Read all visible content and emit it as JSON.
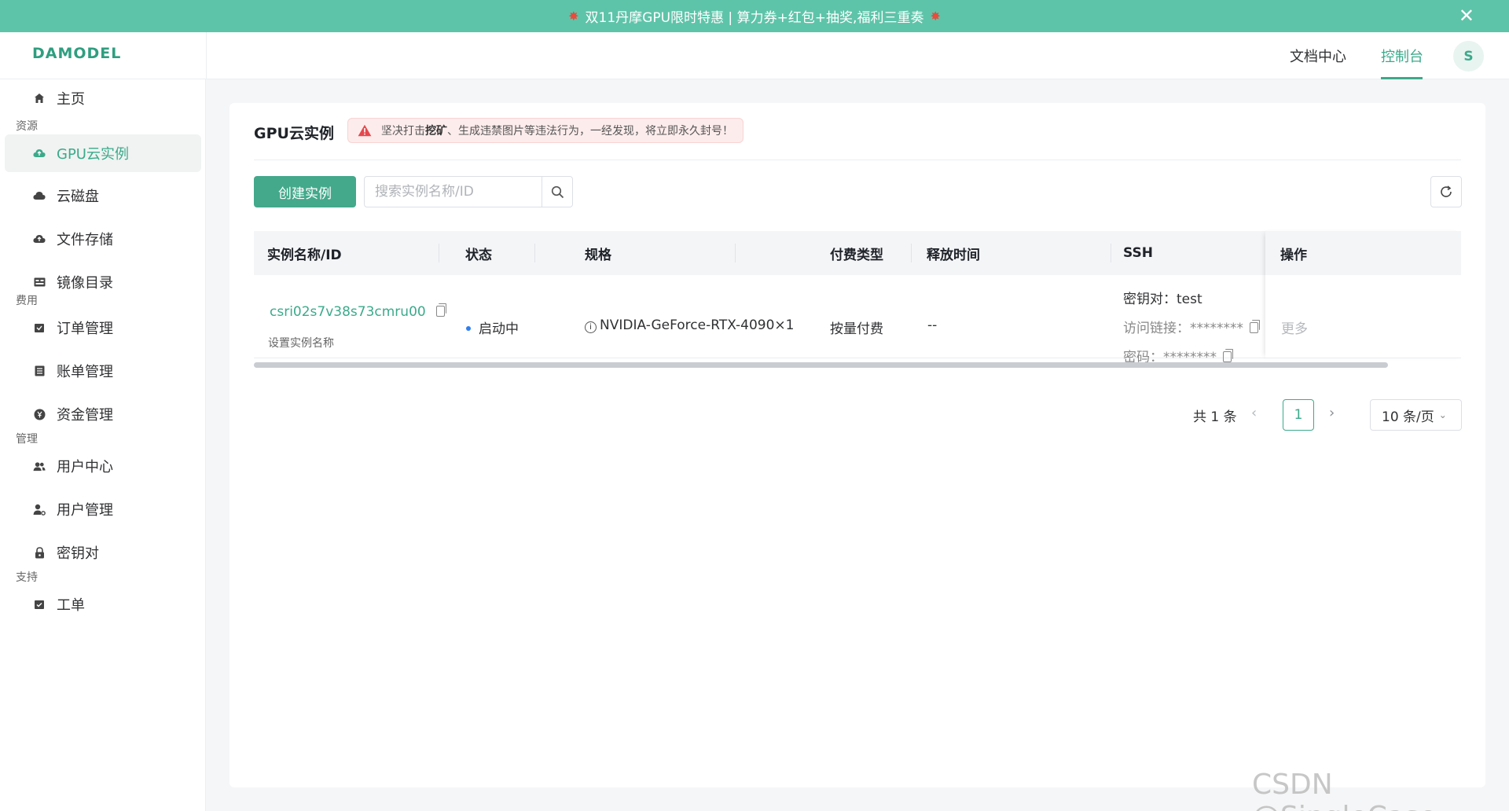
{
  "banner": {
    "text": "双11丹摩GPU限时特惠 | 算力券+红包+抽奖,福利三重奏",
    "close_icon": "close-icon"
  },
  "header": {
    "logo": "DAMODEL",
    "nav": {
      "docs": "文档中心",
      "console": "控制台"
    },
    "avatar": "S",
    "accent_color": "#3caa8a"
  },
  "sidebar": {
    "home": "主页",
    "sections": {
      "resources": "资源",
      "billing": "费用",
      "management": "管理",
      "support": "支持"
    },
    "items": {
      "gpu": "GPU云实例",
      "disk": "云磁盘",
      "storage": "文件存储",
      "images": "镜像目录",
      "orders": "订单管理",
      "bills": "账单管理",
      "funds": "资金管理",
      "user_center": "用户中心",
      "user_mgmt": "用户管理",
      "keypair": "密钥对",
      "ticket": "工单"
    }
  },
  "main": {
    "title": "GPU云实例",
    "warning": {
      "prefix": "坚决打击 ",
      "bold": "挖矿",
      "suffix": "、生成违禁图片等违法行为，一经发现，将立即永久封号！"
    },
    "create_button": "创建实例",
    "search_placeholder": "搜索实例名称/ID"
  },
  "table": {
    "headers": {
      "name": "实例名称/ID",
      "status": "状态",
      "spec": "规格",
      "billing": "付费类型",
      "release": "释放时间",
      "ssh": "SSH",
      "actions": "操作"
    },
    "row": {
      "id": "csri02s7v38s73cmru00",
      "set_name": "设置实例名称",
      "status": "启动中",
      "status_color": "#2f7ff0",
      "spec": "NVIDIA-GeForce-RTX-4090×1",
      "billing": "按量付费",
      "release": "--",
      "ssh_keypair": "密钥对：test",
      "ssh_link_label": "访问链接：",
      "ssh_link_value": "********",
      "ssh_pwd_label": "密码：",
      "ssh_pwd_value": "********",
      "action_more": "更多"
    }
  },
  "pagination": {
    "total": "共 1 条",
    "current_page": "1",
    "page_size": "10 条/页"
  },
  "watermark": "CSDN @SingleCase"
}
